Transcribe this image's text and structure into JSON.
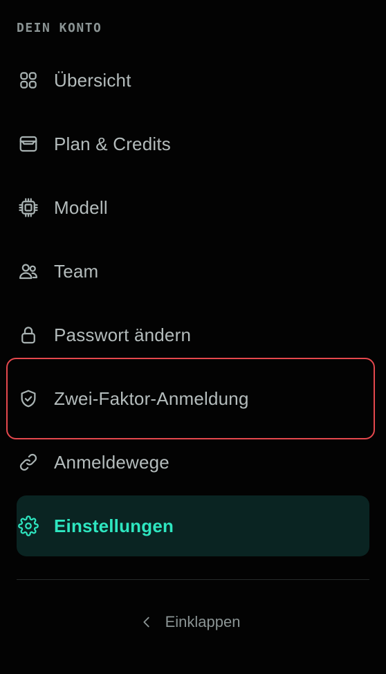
{
  "section": {
    "title": "DEIN KONTO"
  },
  "nav": {
    "items": [
      {
        "label": "Übersicht",
        "icon": "grid-icon"
      },
      {
        "label": "Plan & Credits",
        "icon": "wallet-icon"
      },
      {
        "label": "Modell",
        "icon": "cpu-icon"
      },
      {
        "label": "Team",
        "icon": "users-icon"
      },
      {
        "label": "Passwort ändern",
        "icon": "lock-icon"
      },
      {
        "label": "Zwei-Faktor-Anmeldung",
        "icon": "shield-check-icon"
      },
      {
        "label": "Anmeldewege",
        "icon": "link-icon"
      },
      {
        "label": "Einstellungen",
        "icon": "gear-icon",
        "active": true
      }
    ]
  },
  "footer": {
    "collapse_label": "Einklappen",
    "collapse_icon": "chevron-left-icon"
  },
  "colors": {
    "background": "#030303",
    "text": "#b4bcbc",
    "accent": "#2ee6c0",
    "active_bg": "#0a2422",
    "highlight_border": "#e5484d"
  }
}
